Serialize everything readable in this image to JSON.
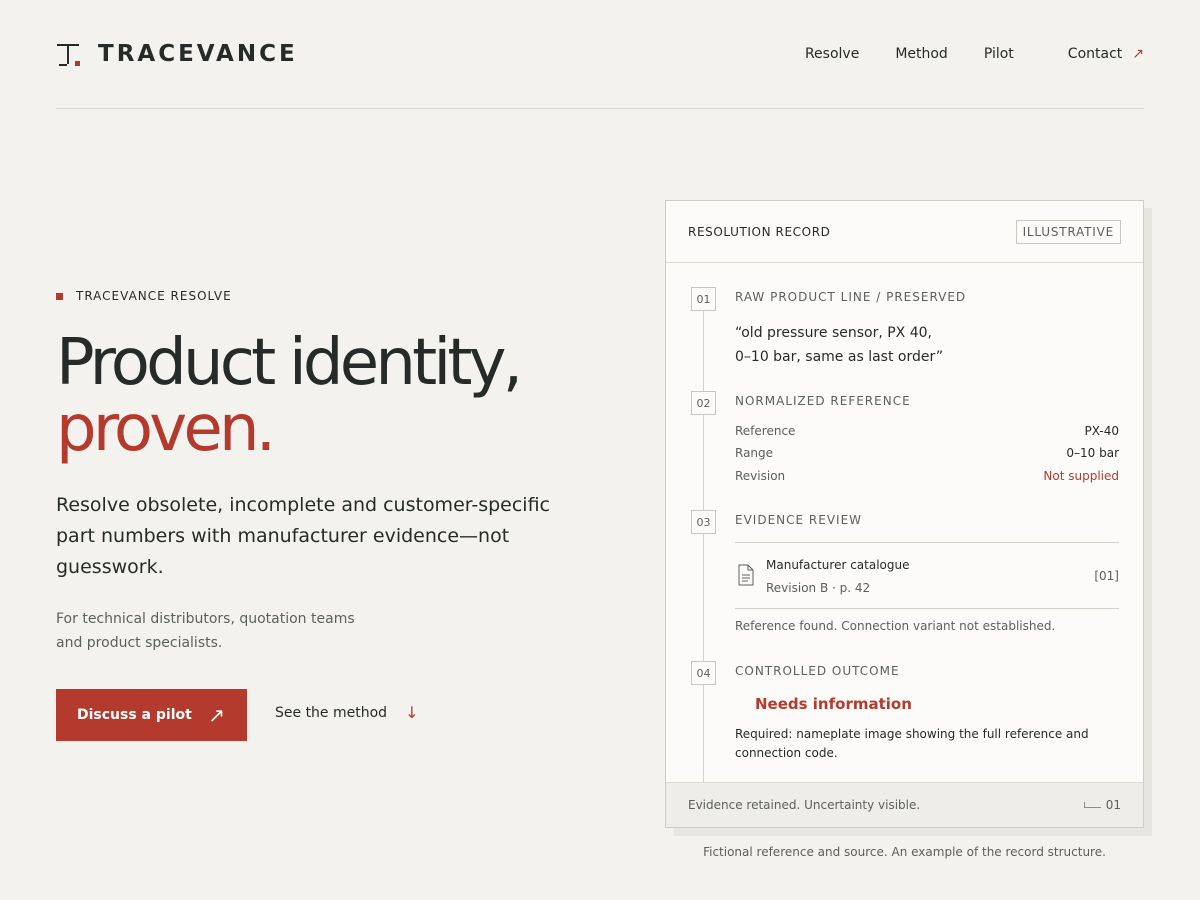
{
  "brand": {
    "name": "TRACEVANCE"
  },
  "nav": {
    "items": [
      "Resolve",
      "Method",
      "Pilot"
    ],
    "contact": "Contact",
    "contact_arrow": "↗"
  },
  "hero": {
    "eyebrow": "TRACEVANCE RESOLVE",
    "headline_line1": "Product identity,",
    "headline_line2": "proven.",
    "lede": "Resolve obsolete, incomplete and customer-specific part numbers with manufacturer evidence—not guesswork.",
    "audience": "For technical distributors, quotation teams and product specialists.",
    "cta_label": "Discuss a pilot",
    "cta_arrow": "↗",
    "secondary_label": "See the method",
    "secondary_arrow": "↓"
  },
  "record": {
    "title": "RESOLUTION RECORD",
    "tag": "ILLUSTRATIVE",
    "steps": [
      {
        "num": "01",
        "label": "RAW PRODUCT LINE / PRESERVED"
      },
      {
        "num": "02",
        "label": "NORMALIZED REFERENCE"
      },
      {
        "num": "03",
        "label": "EVIDENCE REVIEW"
      },
      {
        "num": "04",
        "label": "CONTROLLED OUTCOME"
      }
    ],
    "raw_line1": "“old pressure sensor, PX 40,",
    "raw_line2": "0–10 bar, same as last order”",
    "normalized": [
      {
        "key": "Reference",
        "value": "PX-40"
      },
      {
        "key": "Range",
        "value": "0–10 bar"
      },
      {
        "key": "Revision",
        "value": "Not supplied"
      }
    ],
    "evidence": {
      "title": "Manufacturer catalogue",
      "meta": "Revision B · p. 42",
      "ref": "[01]",
      "note": "Reference found. Connection variant not established."
    },
    "outcome": "Needs information",
    "required": "Required: nameplate image showing the full reference and connection code.",
    "footer_text": "Evidence retained. Uncertainty visible.",
    "footer_page": "01"
  },
  "caption": "Fictional reference and source. An example of the record structure.",
  "colors": {
    "accent": "#b33a2c",
    "background": "#f4f2ee",
    "ink": "#262b29"
  },
  "icons": [
    "logo-mark-icon",
    "arrow-up-right-icon",
    "arrow-down-icon",
    "document-icon",
    "corner-bracket-icon"
  ]
}
